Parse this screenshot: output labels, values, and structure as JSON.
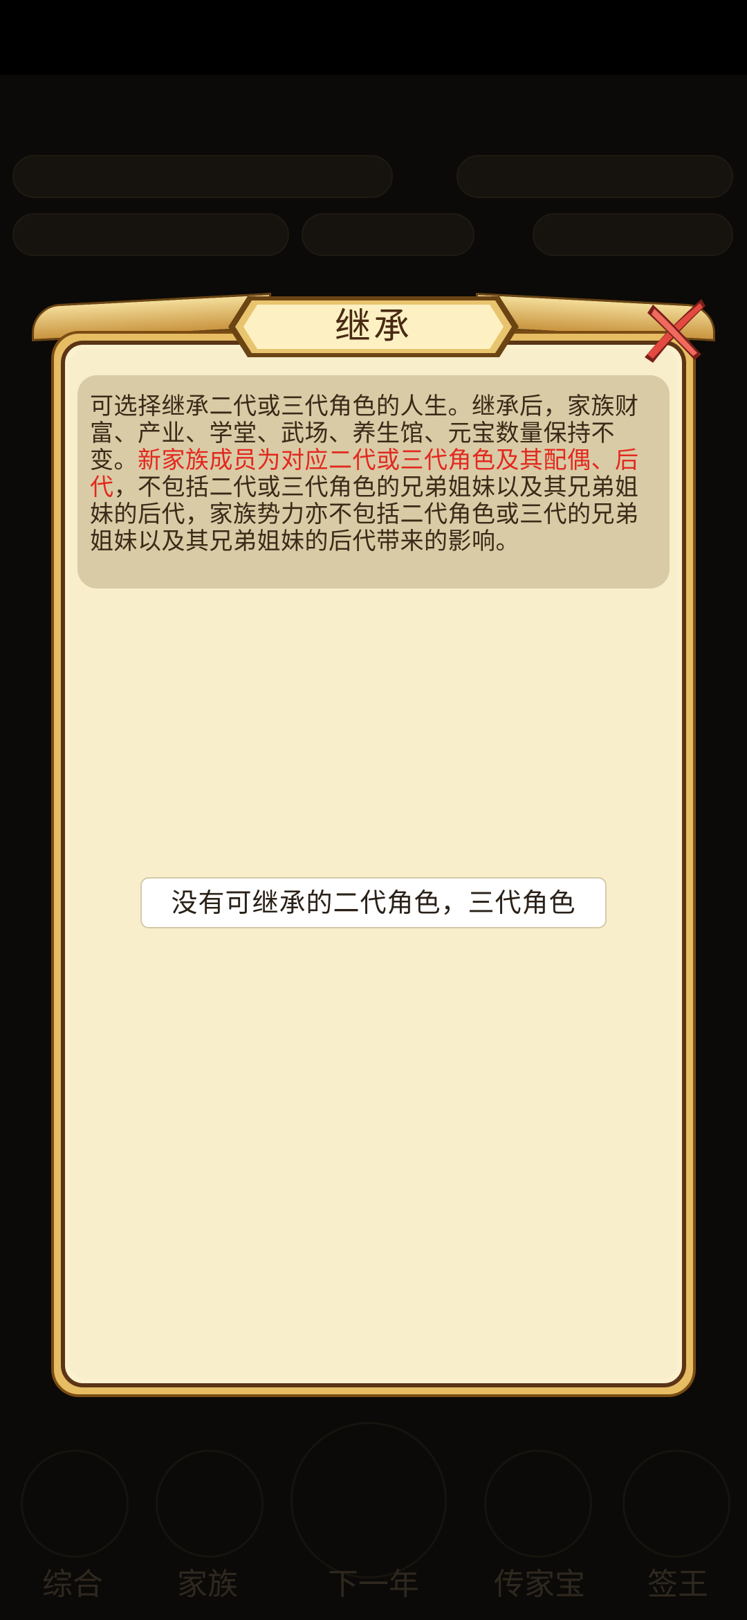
{
  "dialog": {
    "title": "继承",
    "description_part1": "可选择继承二代或三代角色的人生。继承后，家族财富、产业、学堂、武场、养生馆、元宝数量保持不变。",
    "description_highlight": "新家族成员为对应二代或三代角色及其配偶、后代",
    "description_part2": "，不包括二代或三代角色的兄弟姐妹以及其兄弟姐妹的后代，家族势力亦不包括二代角色或三代的兄弟姐妹以及其兄弟姐妹的后代带来的影响。",
    "empty_message": "没有可继承的二代角色，三代角色",
    "close_icon": "close-x-icon"
  },
  "background": {
    "bottom_nav": [
      "综合",
      "家族",
      "下一年",
      "传家宝",
      "签王"
    ]
  },
  "colors": {
    "highlight": "#e2291f",
    "panel": "#f8eecc",
    "frame_gold": "#e6bd63",
    "close_red": "#d9413a"
  }
}
